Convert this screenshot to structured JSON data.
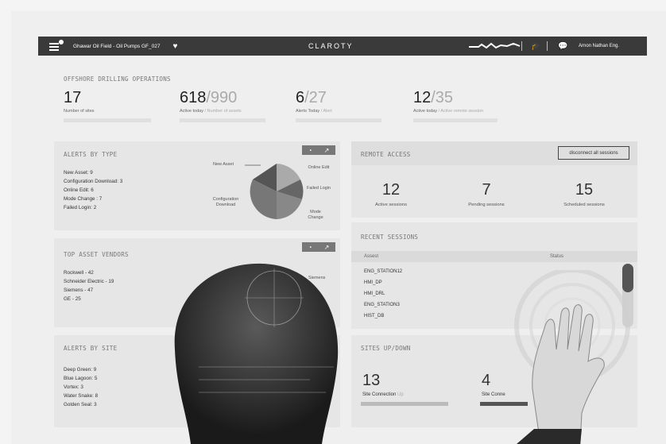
{
  "topbar": {
    "site": "Ghawar Oil Field - Oil Pumps GF_027",
    "logo": "CLAROTY",
    "user": "Arnon Nathan Eng."
  },
  "overview": {
    "title": "Offshore Drilling Operations",
    "kpis": [
      {
        "value": "17",
        "of": "",
        "label": "Number of sites",
        "label_muted": ""
      },
      {
        "value": "618",
        "of": "/990",
        "label": "Active today",
        "label_muted": " / Number of assets"
      },
      {
        "value": "6",
        "of": "/27",
        "label": "Alerts Today",
        "label_muted": " / Alert"
      },
      {
        "value": "12",
        "of": "/35",
        "label": "Active today",
        "label_muted": " / Active remote session"
      }
    ]
  },
  "alerts_by_type": {
    "title": "Alerts by Type",
    "items": [
      "New Asset: 9",
      "Configuration Download: 3",
      "Online Edit: 6",
      "Mode Change : 7",
      "Failed Login: 2"
    ],
    "labels": {
      "new_asset": "New Asset",
      "online_edit": "Online Edit",
      "failed_login": "Failed Login",
      "mode_change": "Mode Change",
      "config_download": "Configuration Download"
    }
  },
  "top_vendors": {
    "title": "Top Asset Vendors",
    "items": [
      "Rockwell - 42",
      "Schneider Electric - 19",
      "Siemens - 47",
      "GE - 25"
    ],
    "pie_label": "Siemens"
  },
  "alerts_by_site": {
    "title": "Alerts by Site",
    "items": [
      "Deep Green: 9",
      "Blue Lagoon: 5",
      "Vortex: 3",
      "Water Snake: 8",
      "Golden Seal: 3"
    ]
  },
  "remote_access": {
    "title": "Remote Access",
    "disconnect_label": "disconnect all sessions",
    "stats": [
      {
        "value": "12",
        "label": "Active sessions"
      },
      {
        "value": "7",
        "label": "Pending sessions"
      },
      {
        "value": "15",
        "label": "Scheduled sessions"
      }
    ]
  },
  "recent_sessions": {
    "title": "Recent Sessions",
    "col_asset": "Assest",
    "col_status": "Status",
    "rows": [
      "ENG_STATION12",
      "HMI_DP",
      "HMI_DRL",
      "ENG_STATION3",
      "HIST_DB"
    ]
  },
  "sites_updown": {
    "title": "Sites Up/Down",
    "up_value": "13",
    "up_label": "Site Connection",
    "up_state": "Up",
    "down_value": "4",
    "down_label": "Site Conne"
  }
}
